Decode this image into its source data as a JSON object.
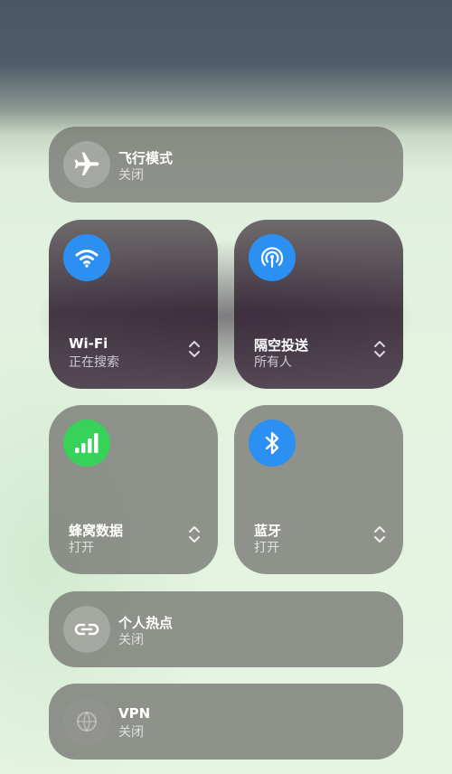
{
  "airplane": {
    "title": "飞行模式",
    "status": "关闭",
    "icon": "airplane-icon"
  },
  "wifi": {
    "title": "Wi-Fi",
    "status": "正在搜索",
    "icon": "wifi-icon",
    "color": "#2c8ff2"
  },
  "airdrop": {
    "title": "隔空投送",
    "status": "所有人",
    "icon": "airdrop-icon",
    "color": "#2c8ff2"
  },
  "cellular": {
    "title": "蜂窝数据",
    "status": "打开",
    "icon": "cellular-icon",
    "color": "#36d25a"
  },
  "bluetooth": {
    "title": "蓝牙",
    "status": "打开",
    "icon": "bluetooth-icon",
    "color": "#2c8ff2"
  },
  "hotspot": {
    "title": "个人热点",
    "status": "关闭",
    "icon": "hotspot-icon"
  },
  "vpn": {
    "title": "VPN",
    "status": "关闭",
    "icon": "vpn-icon"
  }
}
